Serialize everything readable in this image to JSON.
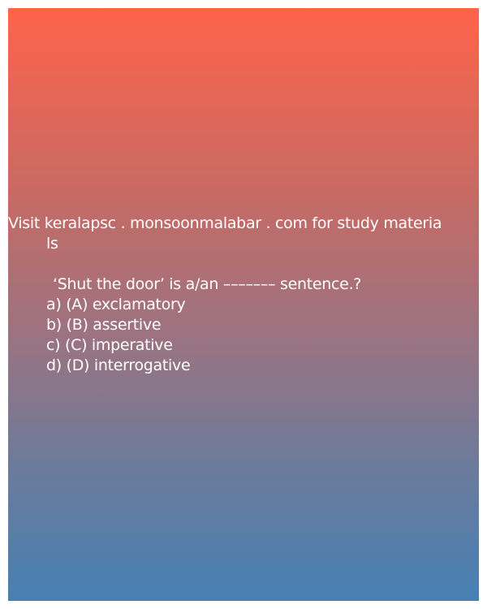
{
  "promo": {
    "line1": "Visit keralapsc . monsoonmalabar . com for study materia",
    "line2": "ls"
  },
  "question": {
    "text": "‘Shut the door’ is a/an ––––––– sentence.?"
  },
  "options": [
    "a) (A) exclamatory",
    "b) (B) assertive",
    "c) (C) imperative",
    "d) (D) interrogative"
  ],
  "colors": {
    "gradient_top": "#ff634a",
    "gradient_bottom": "#4680b4",
    "text": "#ffffff"
  }
}
